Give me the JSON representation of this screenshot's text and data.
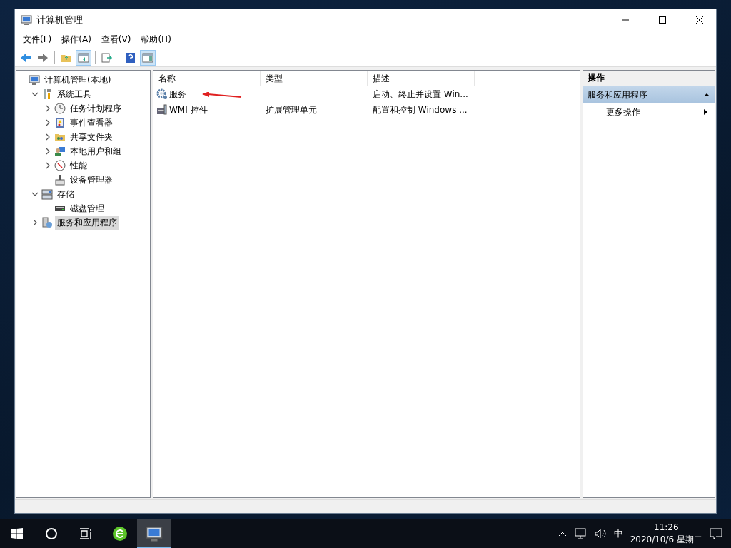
{
  "window": {
    "title": "计算机管理"
  },
  "menu": [
    "文件(F)",
    "操作(A)",
    "查看(V)",
    "帮助(H)"
  ],
  "toolbar": [
    {
      "kind": "back",
      "selected": false
    },
    {
      "kind": "forward",
      "selected": false
    },
    {
      "kind": "sep"
    },
    {
      "kind": "up",
      "selected": false
    },
    {
      "kind": "tree",
      "selected": true
    },
    {
      "kind": "sep"
    },
    {
      "kind": "export",
      "selected": false
    },
    {
      "kind": "sep"
    },
    {
      "kind": "help",
      "selected": false
    },
    {
      "kind": "pane",
      "selected": true
    }
  ],
  "tree": [
    {
      "label": "计算机管理(本地)",
      "selected": false,
      "children": [
        {
          "label": "系统工具",
          "expanded": true,
          "selected": false,
          "children": [
            {
              "label": "任务计划程序",
              "expanded": false,
              "selected": false
            },
            {
              "label": "事件查看器",
              "expanded": false,
              "selected": false
            },
            {
              "label": "共享文件夹",
              "expanded": false,
              "selected": false
            },
            {
              "label": "本地用户和组",
              "expanded": false,
              "selected": false
            },
            {
              "label": "性能",
              "expanded": false,
              "selected": false
            },
            {
              "label": "设备管理器",
              "selected": false
            }
          ]
        },
        {
          "label": "存储",
          "expanded": true,
          "selected": false,
          "children": [
            {
              "label": "磁盘管理",
              "selected": false
            }
          ]
        },
        {
          "label": "服务和应用程序",
          "expanded": false,
          "selected": true
        }
      ]
    }
  ],
  "table": {
    "columns": [
      "名称",
      "类型",
      "描述"
    ],
    "rows": [
      {
        "kind": "gear",
        "cells": [
          "服务",
          "",
          "启动、终止并设置 Win..."
        ]
      },
      {
        "kind": "wmi",
        "cells": [
          "WMI 控件",
          "扩展管理单元",
          "配置和控制 Windows ..."
        ]
      }
    ]
  },
  "actions": {
    "title": "操作",
    "section": {
      "label": "服务和应用程序",
      "expanded": true
    },
    "items": [
      {
        "label": "更多操作"
      }
    ]
  },
  "taskbar": {
    "items": [
      {
        "kind": "start",
        "selected": false
      },
      {
        "kind": "search",
        "selected": false
      },
      {
        "kind": "taskview",
        "selected": false
      },
      {
        "kind": "browser",
        "selected": false
      },
      {
        "kind": "compmgmt",
        "selected": true
      }
    ],
    "ime": "中",
    "time": "11:26",
    "date": "2020/10/6 星期二"
  }
}
